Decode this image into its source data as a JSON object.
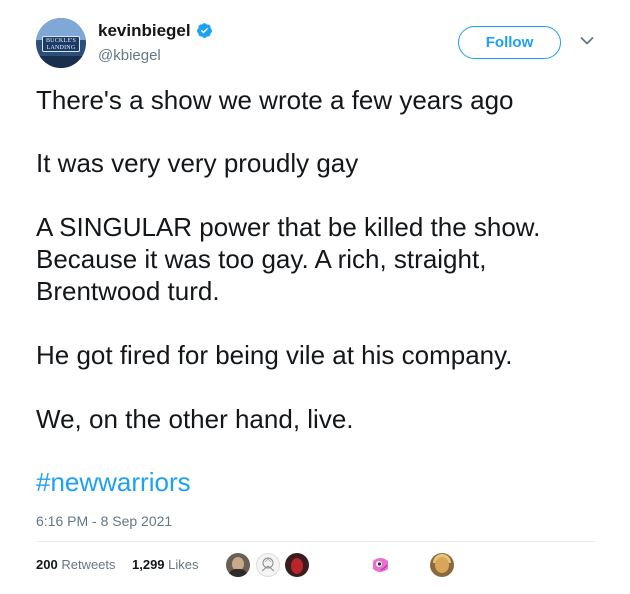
{
  "user": {
    "display_name": "kevinbiegel",
    "handle": "@kbiegel",
    "avatar_sign_line1": "BUCKLE'S",
    "avatar_sign_line2": "LANDING"
  },
  "follow_label": "Follow",
  "tweet": {
    "paragraphs": [
      "There's a show we wrote a few years ago",
      "It was very very proudly gay",
      "A SINGULAR power that be killed the show.",
      "Because it was too gay. A rich, straight,",
      "Brentwood turd.",
      "He got fired for being vile at his company.",
      "We, on the other hand, live."
    ],
    "hashtag": "#newwarriors",
    "timestamp": "6:16 PM - 8 Sep 2021"
  },
  "stats": {
    "retweets_count": "200",
    "retweets_label": "Retweets",
    "likes_count": "1,299",
    "likes_label": "Likes"
  },
  "colors": {
    "accent": "#1da1f2",
    "text": "#14171a",
    "secondary": "#657786",
    "divider": "#e6ecf0"
  },
  "icons": [
    "verified-badge-icon",
    "chevron-down-icon"
  ]
}
